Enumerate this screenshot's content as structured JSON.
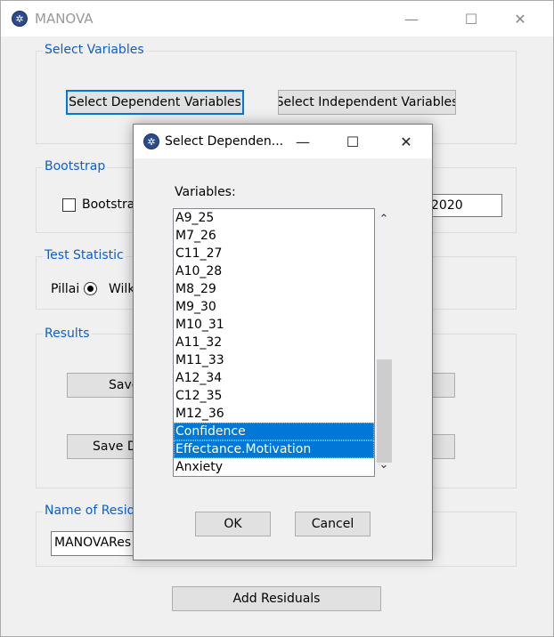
{
  "main_window": {
    "title": "MANOVA",
    "icon": "app-icon",
    "controls": {
      "minimize": "—",
      "maximize": "☐",
      "close": "✕"
    },
    "select_variables": {
      "legend": "Select Variables",
      "dependent_button": "Select Dependent Variables",
      "independent_button": "Select Independent Variables"
    },
    "bootstrap": {
      "legend": "Bootstrap",
      "checkbox_label": "Bootstrap",
      "checked": false,
      "seed_value": "2020"
    },
    "test_statistic": {
      "legend": "Test Statistic",
      "options": [
        "Pillai",
        "Wilk"
      ],
      "selected": "Pillai"
    },
    "results": {
      "legend": "Results",
      "save_button_1": "Save",
      "save_button_2": "Save D"
    },
    "residuals": {
      "legend": "Name of Residu",
      "name_value": "MANOVARes",
      "add_button": "Add Residuals"
    }
  },
  "dialog": {
    "title": "Select Dependen...",
    "controls": {
      "minimize": "—",
      "maximize": "☐",
      "close": "✕"
    },
    "variables_label": "Variables:",
    "items": [
      {
        "label": "A9_25",
        "selected": false
      },
      {
        "label": "M7_26",
        "selected": false
      },
      {
        "label": "C11_27",
        "selected": false
      },
      {
        "label": "A10_28",
        "selected": false
      },
      {
        "label": "M8_29",
        "selected": false
      },
      {
        "label": "M9_30",
        "selected": false
      },
      {
        "label": "M10_31",
        "selected": false
      },
      {
        "label": "A11_32",
        "selected": false
      },
      {
        "label": "M11_33",
        "selected": false
      },
      {
        "label": "A12_34",
        "selected": false
      },
      {
        "label": "C12_35",
        "selected": false
      },
      {
        "label": "M12_36",
        "selected": false
      },
      {
        "label": "Confidence",
        "selected": true
      },
      {
        "label": "Effectance.Motivation",
        "selected": true
      },
      {
        "label": "Anxiety",
        "selected": false
      }
    ],
    "ok_button": "OK",
    "cancel_button": "Cancel",
    "scroll_up": "⌃",
    "scroll_down": "⌄"
  },
  "colors": {
    "accent": "#0078d7",
    "legend": "#0b5ed7",
    "background": "#f0f0f0"
  }
}
